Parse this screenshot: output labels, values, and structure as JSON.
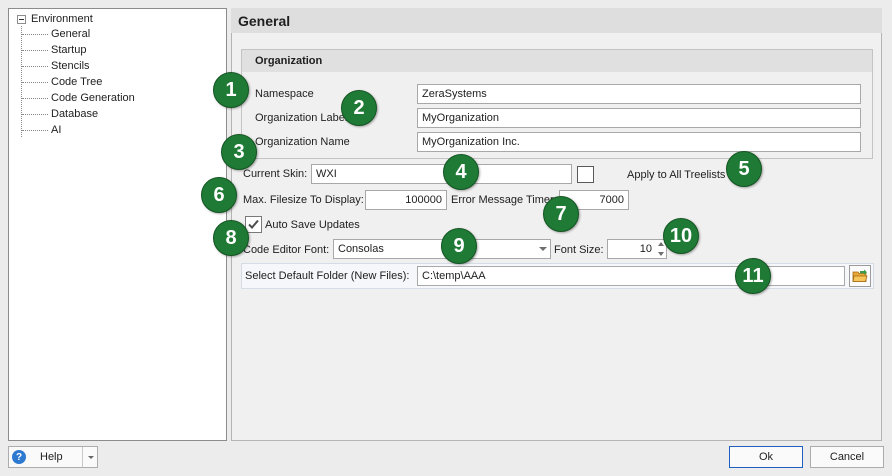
{
  "tree": {
    "root": "Environment",
    "children": [
      "General",
      "Startup",
      "Stencils",
      "Code Tree",
      "Code Generation",
      "Database",
      "AI"
    ]
  },
  "panel": {
    "title": "General"
  },
  "organization": {
    "header": "Organization",
    "namespace_label": "Namespace",
    "namespace_value": "ZeraSystems",
    "org_label_label": "Organization Label",
    "org_label_value": "MyOrganization",
    "org_name_label": "Organization Name",
    "org_name_value": "MyOrganization Inc."
  },
  "skin": {
    "label": "Current Skin:",
    "value": "WXI",
    "apply_all_label": "Apply to All Treelists",
    "apply_all_checked": false
  },
  "filesize": {
    "label": "Max. Filesize To Display:",
    "value": "100000"
  },
  "error_timer": {
    "label": "Error Message Timer:",
    "value": "7000"
  },
  "autosave": {
    "label": "Auto Save Updates",
    "checked": true
  },
  "editor_font": {
    "label": "Code Editor Font:",
    "value": "Consolas"
  },
  "font_size": {
    "label": "Font Size:",
    "value": "10"
  },
  "default_folder": {
    "label": "Select Default Folder (New Files):",
    "value": "C:\\temp\\AAA"
  },
  "badges": [
    "1",
    "2",
    "3",
    "4",
    "5",
    "6",
    "7",
    "8",
    "9",
    "10",
    "11"
  ],
  "footer": {
    "help_label": "Help",
    "ok_label": "Ok",
    "cancel_label": "Cancel"
  },
  "colors": {
    "badge": "#1f7a35",
    "accent": "#1e5fbf"
  }
}
